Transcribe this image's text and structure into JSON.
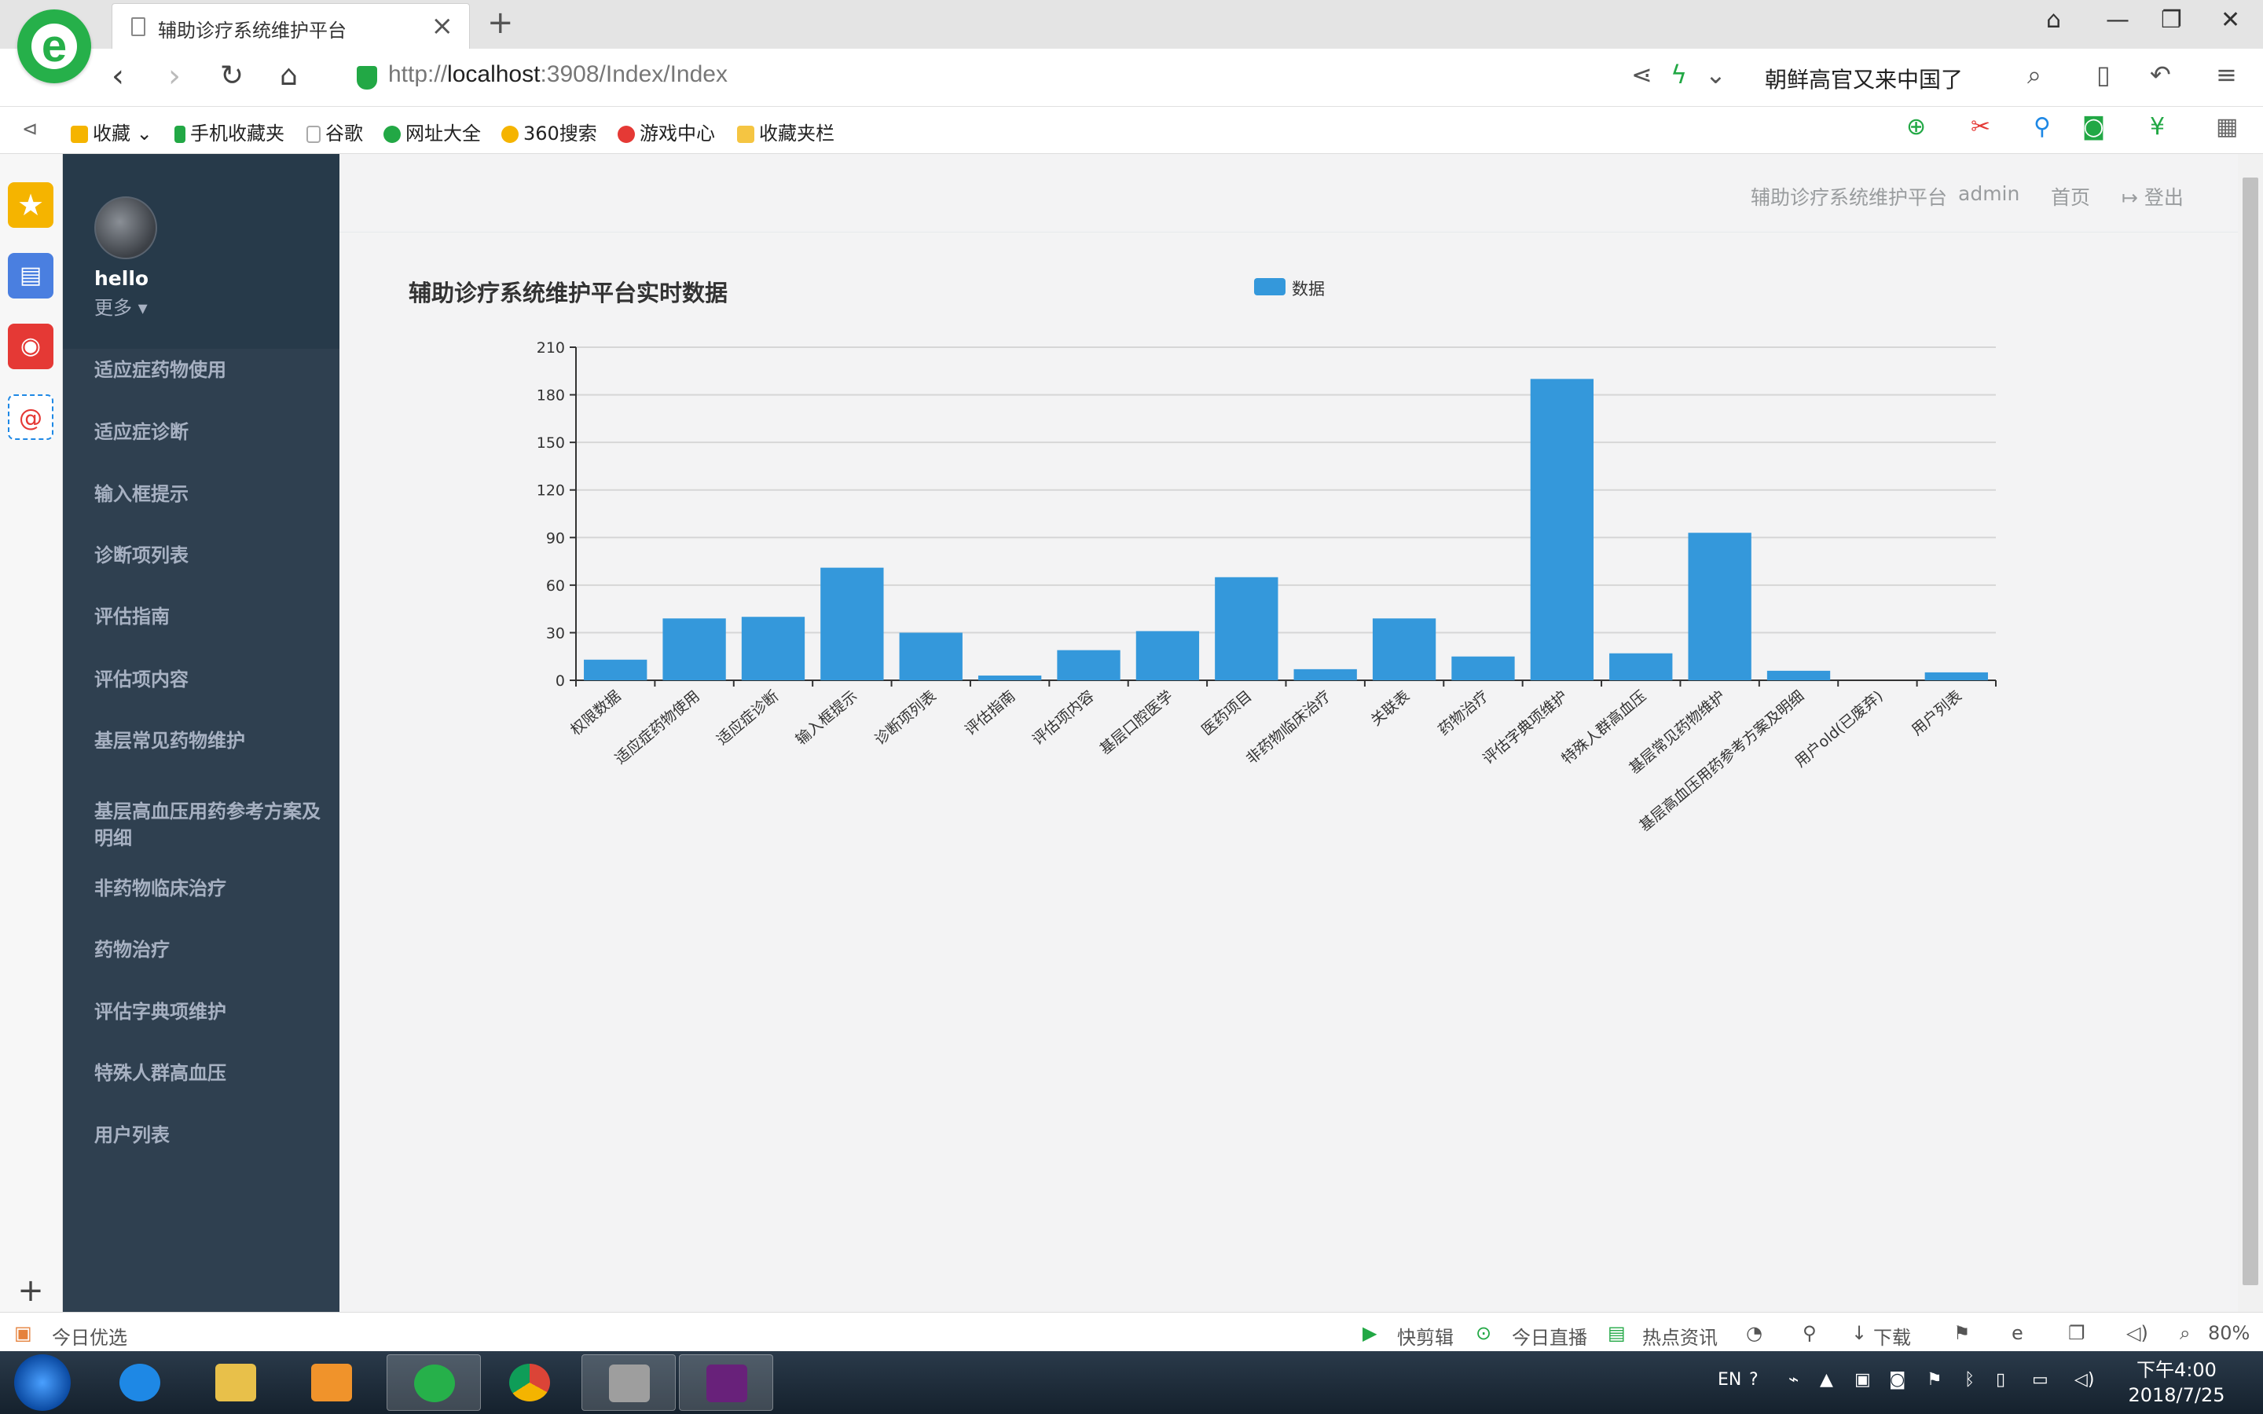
{
  "browser": {
    "tab_title": "辅助诊疗系统维护平台",
    "url_prefix": "http://",
    "url_host": "localhost",
    "url_rest": ":3908/Index/Index",
    "news_text": "朝鲜高官又来中国了",
    "logo_glyph": "e"
  },
  "favorites": [
    {
      "label": "收藏",
      "color": "#f5b400"
    },
    {
      "label": "手机收藏夹",
      "color": "#22a845"
    },
    {
      "label": "谷歌",
      "color": "#bbbbbb"
    },
    {
      "label": "网址大全",
      "color": "#22a845"
    },
    {
      "label": "360搜索",
      "color": "#f5b400"
    },
    {
      "label": "游戏中心",
      "color": "#e53935"
    },
    {
      "label": "收藏夹栏",
      "color": "#f5c542"
    }
  ],
  "app": {
    "user": {
      "name": "hello",
      "more": "更多"
    },
    "nav": [
      "适应症药物使用",
      "适应症诊断",
      "输入框提示",
      "诊断项列表",
      "评估指南",
      "评估项内容",
      "基层常见药物维护",
      "基层高血压用药参考方案及明细",
      "非药物临床治疗",
      "药物治疗",
      "评估字典项维护",
      "特殊人群高血压",
      "用户列表"
    ],
    "top": {
      "platform": "辅助诊疗系统维护平台",
      "user": "admin",
      "home": "首页",
      "logout": "登出"
    }
  },
  "chart_data": {
    "type": "bar",
    "title": "辅助诊疗系统维护平台实时数据",
    "legend": [
      "数据"
    ],
    "legend_position": "top-center",
    "grid": true,
    "ylim": [
      0,
      210
    ],
    "yticks": [
      0,
      30,
      60,
      90,
      120,
      150,
      180,
      210
    ],
    "color": "#3498db",
    "categories": [
      "权限数据",
      "适应症药物使用",
      "适应症诊断",
      "输入框提示",
      "诊断项列表",
      "评估指南",
      "评估项内容",
      "基层口腔医学",
      "医药项目",
      "非药物临床治疗",
      "关联表",
      "药物治疗",
      "评估字典项维护",
      "特殊人群高血压",
      "基层常见药物维护",
      "基层高血压用药参考方案及明细",
      "用户old(已废弃)",
      "用户列表"
    ],
    "series": [
      {
        "name": "数据",
        "values": [
          13,
          39,
          40,
          71,
          30,
          3,
          19,
          31,
          65,
          7,
          39,
          15,
          190,
          17,
          93,
          6,
          0,
          5
        ]
      }
    ]
  },
  "statusbar": {
    "today": "今日优选",
    "clip": "快剪辑",
    "live": "今日直播",
    "news": "热点资讯",
    "download": "下载",
    "zoom": "80%"
  },
  "taskbar": {
    "lang": "EN",
    "time": "下午4:00",
    "date": "2018/7/25"
  }
}
